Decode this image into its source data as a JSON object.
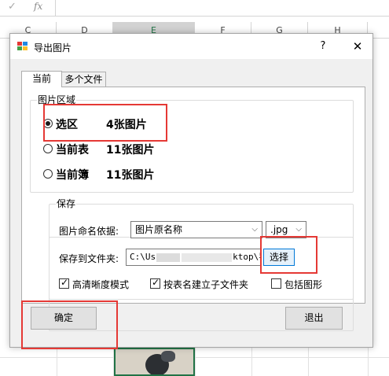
{
  "formula_bar": {
    "cancel_icon": "✓",
    "function_label": "fx"
  },
  "columns": [
    "C",
    "D",
    "E",
    "F",
    "G",
    "H"
  ],
  "selected_column": "E",
  "dialog": {
    "title": "导出图片",
    "help_label": "?",
    "close_label": "✕",
    "tabs": [
      {
        "label": "当前",
        "active": true
      },
      {
        "label": "多个文件",
        "active": false
      }
    ],
    "image_area": {
      "label": "图片区域",
      "options": [
        {
          "label": "选区",
          "count": "4张图片",
          "checked": true
        },
        {
          "label": "当前表",
          "count": "11张图片",
          "checked": false
        },
        {
          "label": "当前簿",
          "count": "11张图片",
          "checked": false
        }
      ]
    },
    "save": {
      "label": "保存",
      "naming_label": "图片命名依据:",
      "naming_value": "图片原名称",
      "format_value": ".jpg",
      "folder_label": "保存到文件夹:",
      "path_prefix": "C:\\Us",
      "path_suffix": "ktop\\导",
      "choose_label": "选择",
      "checkboxes": [
        {
          "label": "高清晰度模式",
          "checked": true
        },
        {
          "label": "按表名建立子文件夹",
          "checked": true
        },
        {
          "label": "包括图形",
          "checked": false
        }
      ]
    },
    "ok_label": "确定",
    "exit_label": "退出"
  },
  "colors": {
    "highlight": "#e53935",
    "excel_green": "#217346",
    "focus_blue": "#0078d7"
  }
}
